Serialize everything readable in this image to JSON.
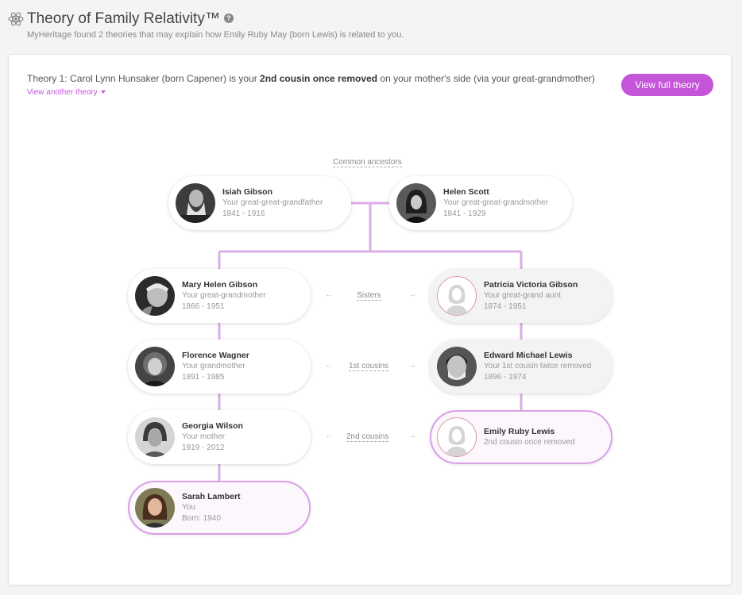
{
  "header": {
    "title": "Theory of Family Relativity™",
    "subtitle": "MyHeritage found 2 theories that may explain how Emily Ruby May (born Lewis) is related to you.",
    "help": "?"
  },
  "theory": {
    "prefix": "Theory 1: Carol Lynn Hunsaker (born Capener) is your ",
    "bold": "2nd cousin once removed",
    "suffix": " on your mother's side (via your great-grandmother)",
    "view_another": "View another theory",
    "full_button": "View full theory"
  },
  "tree": {
    "common_label": "Common ancestors",
    "isiah": {
      "name": "Isiah Gibson",
      "rel": "Your great-great-grandfather",
      "dates": "1841 - 1916"
    },
    "helen": {
      "name": "Helen Scott",
      "rel": "Your great-great-grandmother",
      "dates": "1841 - 1929"
    },
    "mary": {
      "name": "Mary Helen Gibson",
      "rel": "Your great-grandmother",
      "dates": "1866 - 1951"
    },
    "patricia": {
      "name": "Patricia Victoria Gibson",
      "rel": "Your great-grand aunt",
      "dates": "1874 - 1951"
    },
    "florence": {
      "name": "Florence Wagner",
      "rel": "Your grandmother",
      "dates": "1891 - 1985"
    },
    "edward": {
      "name": "Edward Michael Lewis",
      "rel": "Your 1st cousin twice removed",
      "dates": "1896 - 1974"
    },
    "georgia": {
      "name": "Georgia Wilson",
      "rel": "Your mother",
      "dates": "1919 - 2012"
    },
    "emily": {
      "name": "Emily Ruby Lewis",
      "rel": "2nd cousin once removed"
    },
    "sarah": {
      "name": "Sarah Lambert",
      "rel": "You",
      "dates": "Born: 1940"
    },
    "relations": {
      "sisters": "Sisters",
      "first_cousins": "1st cousins",
      "second_cousins": "2nd cousins"
    },
    "arrow_left": "←",
    "arrow_right": "→"
  },
  "colors": {
    "accent": "#c455d9",
    "line": "#dcaee6",
    "highlight_border": "#d9a1e6"
  }
}
